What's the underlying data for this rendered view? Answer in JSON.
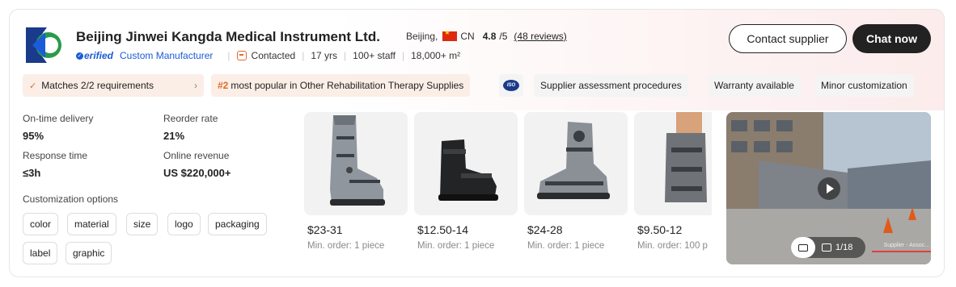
{
  "supplier": {
    "name": "Beijing Jinwei Kangda Medical Instrument Ltd.",
    "location": "Beijing,",
    "country": "CN",
    "rating": "4.8",
    "rating_scale": "/5",
    "reviews": "(48 reviews)",
    "verified": "erified",
    "verified_type": "Custom Manufacturer",
    "contacted": "Contacted",
    "years": "17 yrs",
    "staff": "100+ staff",
    "area": "18,000+ m²"
  },
  "buttons": {
    "contact": "Contact supplier",
    "chat": "Chat now"
  },
  "chips": {
    "matches": "Matches 2/2 requirements",
    "popular_rank": "#2",
    "popular_text": "most popular in Other Rehabilitation Therapy Supplies",
    "iso": "ISO",
    "chip1": "Supplier assessment procedures",
    "chip2": "Warranty available",
    "chip3": "Minor customization"
  },
  "stats": {
    "ontime_label": "On-time delivery",
    "ontime_value": "95%",
    "reorder_label": "Reorder rate",
    "reorder_value": "21%",
    "response_label": "Response time",
    "response_value": "≤3h",
    "revenue_label": "Online revenue",
    "revenue_value": "US $220,000+"
  },
  "customization": {
    "label": "Customization options",
    "tags": [
      "color",
      "material",
      "size",
      "logo",
      "packaging",
      "label",
      "graphic"
    ]
  },
  "products": [
    {
      "price": "$23-31",
      "moq": "Min. order: 1 piece"
    },
    {
      "price": "$12.50-14",
      "moq": "Min. order: 1 piece"
    },
    {
      "price": "$24-28",
      "moq": "Min. order: 1 piece"
    },
    {
      "price": "$9.50-12",
      "moq": "Min. order: 100 p"
    }
  ],
  "video": {
    "count": "1/18",
    "caption": "Supplier - Assoc..."
  },
  "colors": {
    "accent": "#e06a2a",
    "verified": "#1a5cd8",
    "dark_button": "#222222"
  }
}
